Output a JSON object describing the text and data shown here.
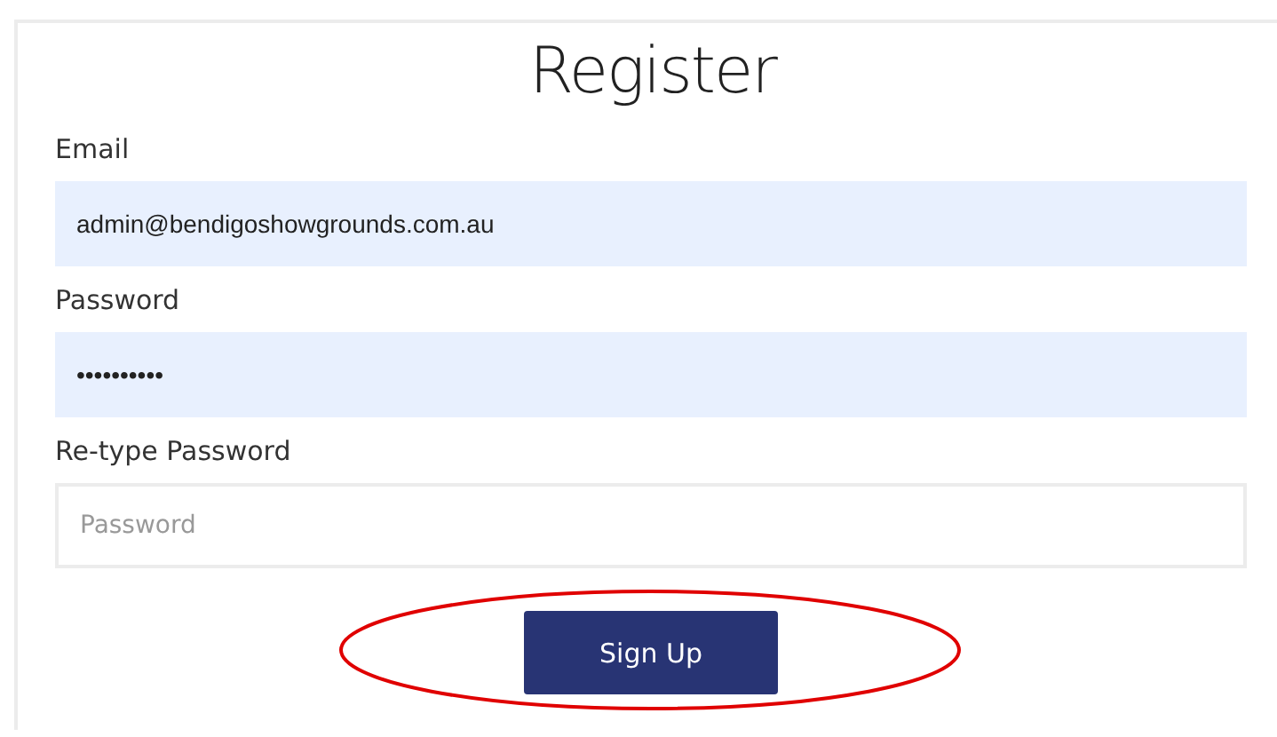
{
  "title": "Register",
  "fields": [
    {
      "label": "Email",
      "value": "admin@bendigoshowgrounds.com.au",
      "autofilled": true
    },
    {
      "label": "Password",
      "value": "••••••••••",
      "autofilled": true
    },
    {
      "label": "Re-type Password",
      "placeholder": "Password",
      "autofilled": false
    }
  ],
  "button": {
    "label": "Sign Up"
  },
  "annotation": {
    "kind": "ellipse"
  }
}
